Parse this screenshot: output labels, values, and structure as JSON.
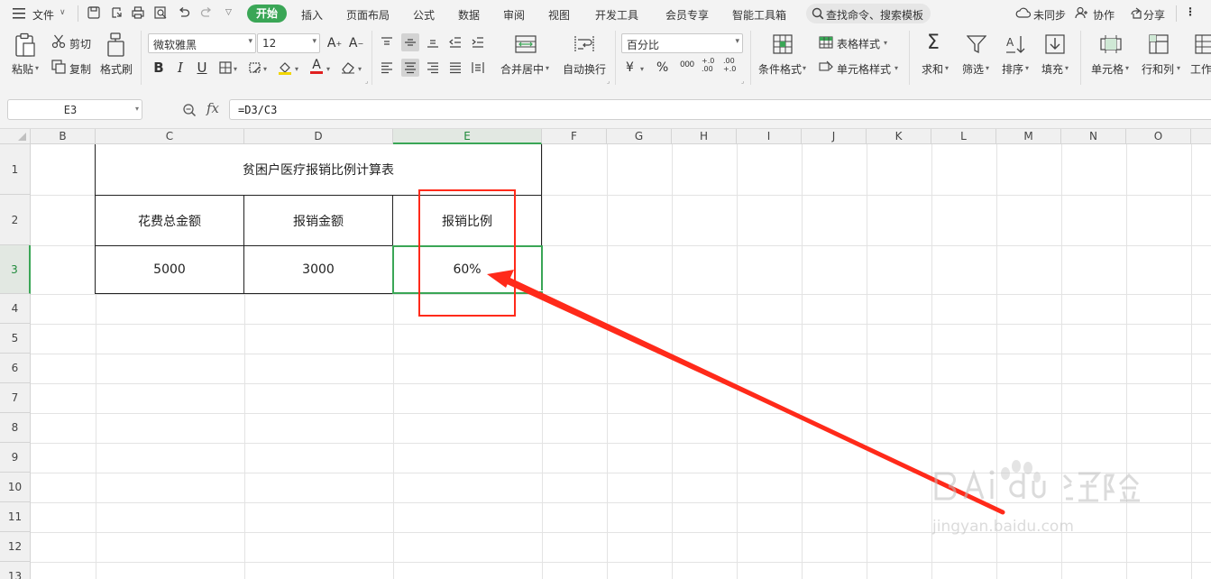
{
  "menu": {
    "file_label": "文件",
    "tabs": [
      "开始",
      "插入",
      "页面布局",
      "公式",
      "数据",
      "审阅",
      "视图",
      "开发工具",
      "会员专享",
      "智能工具箱"
    ],
    "search_placeholder": "查找命令、搜索模板",
    "sync_label": "未同步",
    "collab_label": "协作",
    "share_label": "分享"
  },
  "ribbon": {
    "paste": "粘贴",
    "cut": "剪切",
    "copy": "复制",
    "format_painter": "格式刷",
    "font_name": "微软雅黑",
    "font_size": "12",
    "merge_center": "合并居中",
    "wrap_text": "自动换行",
    "number_format": "百分比",
    "currency_symbol": "¥",
    "percent_symbol": "%",
    "thousands": "000",
    "inc_decimal": "+.0 .00",
    "dec_decimal": ".00 +.0",
    "cond_format": "条件格式",
    "table_style": "表格样式",
    "cell_style": "单元格样式",
    "sum": "求和",
    "filter": "筛选",
    "sort": "排序",
    "fill": "填充",
    "cell": "单元格",
    "row_col": "行和列",
    "worksheet": "工作"
  },
  "formula_bar": {
    "cell_ref": "E3",
    "fx": "fx",
    "formula": "=D3/C3"
  },
  "grid": {
    "columns": [
      "B",
      "C",
      "D",
      "E",
      "F",
      "G",
      "H",
      "I",
      "J",
      "K",
      "L",
      "M",
      "N",
      "O"
    ],
    "rows": [
      "1",
      "2",
      "3",
      "4",
      "5",
      "6",
      "7",
      "8",
      "9",
      "10",
      "11",
      "12",
      "13"
    ],
    "active_col": "E",
    "active_row": "3"
  },
  "table": {
    "title": "贫困户医疗报销比例计算表",
    "headers": [
      "花费总金额",
      "报销金额",
      "报销比例"
    ],
    "values": [
      "5000",
      "3000",
      "60%"
    ]
  },
  "annotation_color": "#ff2a1a",
  "accent_color": "#3aa656",
  "watermark": {
    "logo": "Baidu经验",
    "url": "jingyan.baidu.com"
  }
}
